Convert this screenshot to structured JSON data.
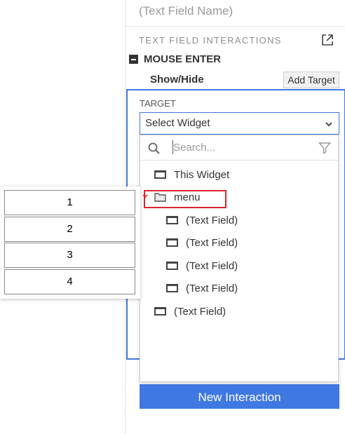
{
  "panel": {
    "field_name": "(Text Field Name)",
    "section_title": "TEXT FIELD INTERACTIONS",
    "event_label": "MOUSE ENTER",
    "action_label": "Show/Hide",
    "add_target_label": "Add Target",
    "target_label": "TARGET",
    "select_value": "Select Widget",
    "new_interaction_label": "New Interaction"
  },
  "dropdown": {
    "search_placeholder": "Search...",
    "items": [
      {
        "label": "This Widget",
        "icon": "widget-icon",
        "level": 0
      },
      {
        "label": "menu",
        "icon": "folder-icon",
        "level": 0,
        "expanded": true
      },
      {
        "label": "(Text Field)",
        "icon": "widget-icon",
        "level": 1
      },
      {
        "label": "(Text Field)",
        "icon": "widget-icon",
        "level": 1
      },
      {
        "label": "(Text Field)",
        "icon": "widget-icon",
        "level": 1
      },
      {
        "label": "(Text Field)",
        "icon": "widget-icon",
        "level": 1
      },
      {
        "label": "(Text Field)",
        "icon": "widget-icon",
        "level": 0
      }
    ]
  },
  "menu_widget": {
    "items": [
      "1",
      "2",
      "3",
      "4"
    ]
  },
  "colors": {
    "accent": "#3e78e0",
    "highlight": "#d9262e"
  }
}
